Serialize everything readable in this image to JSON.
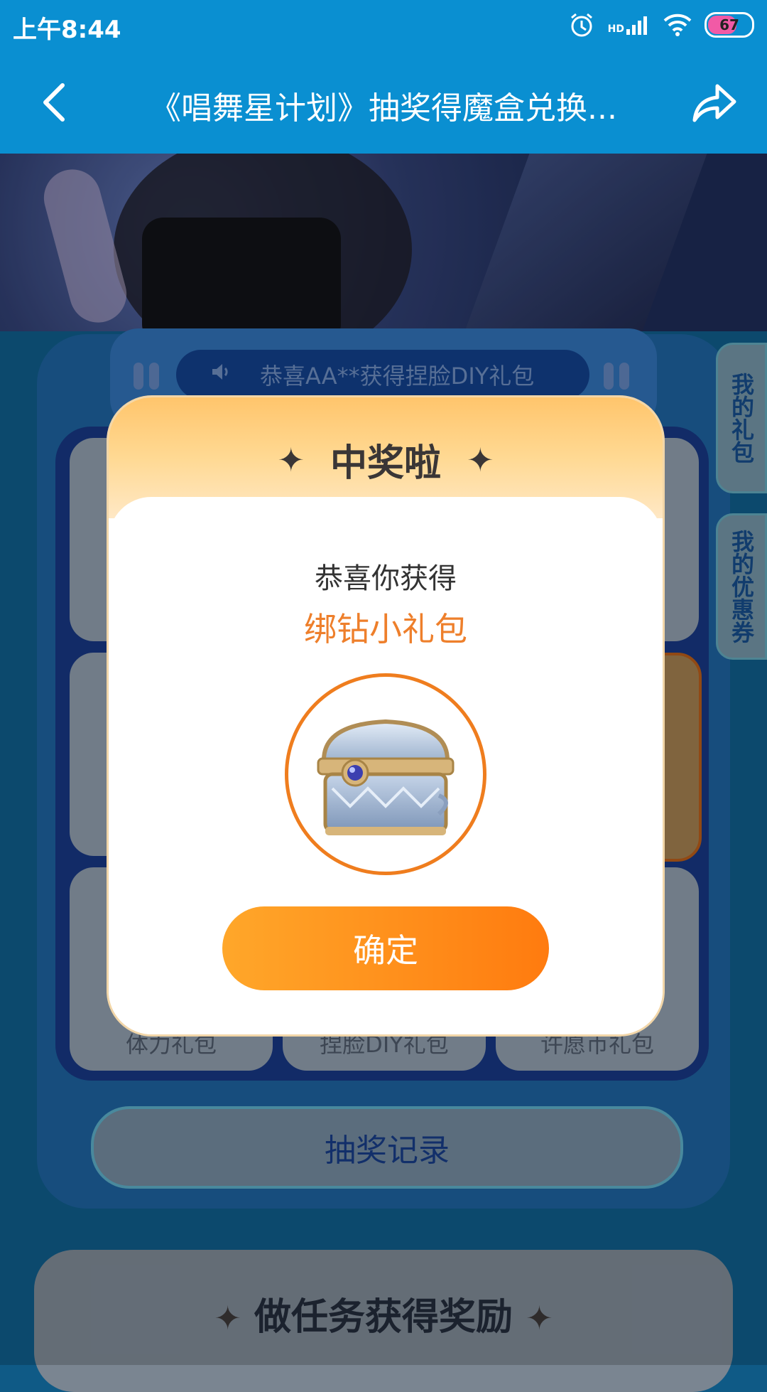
{
  "status_bar": {
    "time": "上午8:44",
    "battery": "67",
    "network": "HD"
  },
  "header": {
    "title": "《唱舞星计划》抽奖得魔盒兑换...",
    "back_icon": "chevron-left-icon",
    "share_icon": "share-icon"
  },
  "ticker": {
    "text": "恭喜AA**获得捏脸DIY礼包"
  },
  "side_tabs": {
    "gifts": "我的礼包",
    "coupons": "我的优惠券"
  },
  "grid": {
    "bottom_labels": [
      "体力礼包",
      "捏脸DIY礼包",
      "许愿币礼包"
    ]
  },
  "record_button": "抽奖记录",
  "task_section": {
    "title": "做任务获得奖励"
  },
  "modal": {
    "title": "中奖啦",
    "congrats": "恭喜你获得",
    "prize_name": "绑钻小礼包",
    "prize_icon": "treasure-chest-icon",
    "confirm": "确定"
  },
  "colors": {
    "accent": "#0a8fd1",
    "orange": "#ef7d1e",
    "prize_text": "#ee7f2b"
  }
}
